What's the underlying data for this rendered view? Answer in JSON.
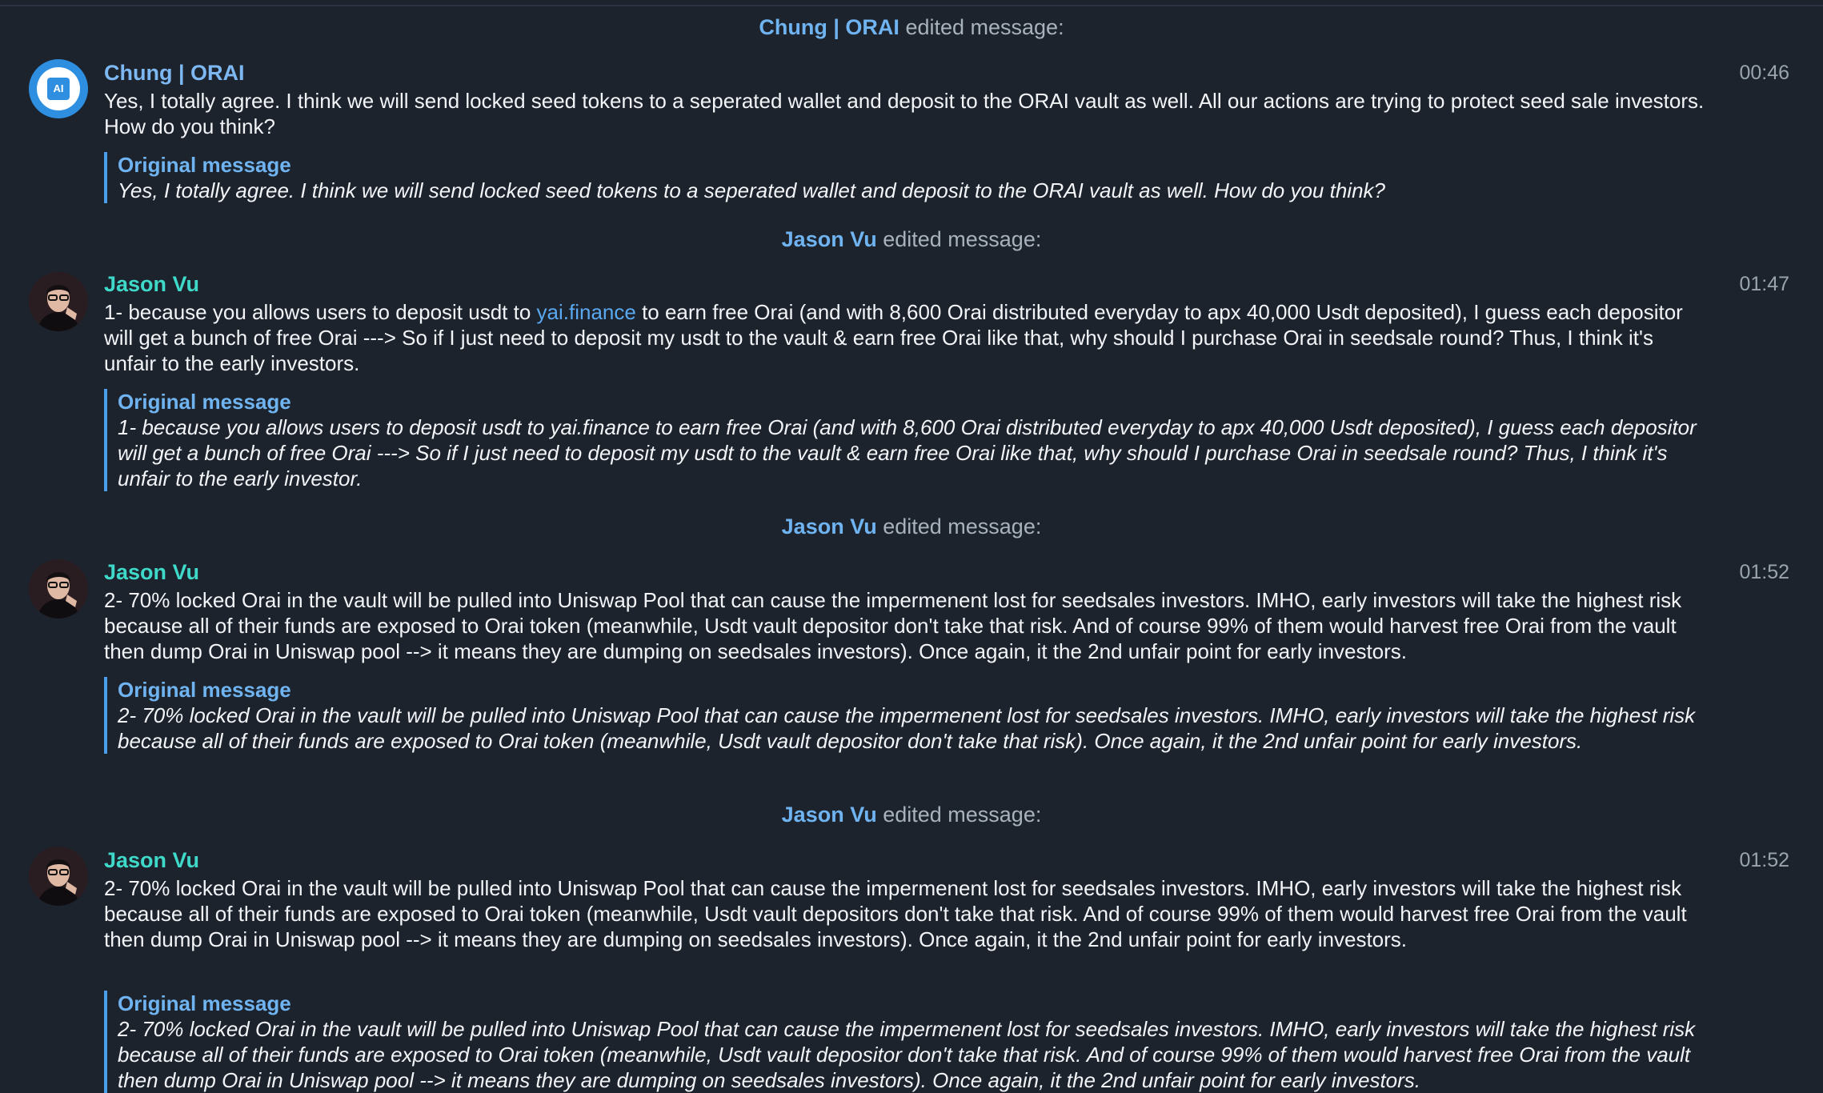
{
  "colors": {
    "background": "#1c232d",
    "link": "#5aa9f0",
    "orai_name": "#7eb8f2",
    "jason_name": "#3fd9c9",
    "quote_bar": "#4a9fea"
  },
  "notices": [
    {
      "name": "Chung | ORAI",
      "suffix": "edited message:"
    },
    {
      "name": "Jason Vu",
      "suffix": "edited message:"
    },
    {
      "name": "Jason Vu",
      "suffix": "edited message:"
    },
    {
      "name": "Jason Vu",
      "suffix": "edited message:"
    }
  ],
  "messages": [
    {
      "sender": "Chung | ORAI",
      "avatar_icon": "orai-ai-logo-icon",
      "avatar_text": "AI",
      "time": "00:46",
      "text": "Yes, I totally agree. I think we will send locked seed tokens to a seperated wallet and deposit to the ORAI vault as well. All our actions are trying to protect seed sale investors. How do you think?",
      "original_title": "Original message",
      "original_text": "Yes, I totally agree. I think we will send locked seed tokens to a seperated wallet and deposit to the ORAI vault as well. How do you think?"
    },
    {
      "sender": "Jason Vu",
      "avatar_icon": "user-photo-icon",
      "time": "01:47",
      "text_before_link": "1- because you allows users to deposit usdt to ",
      "link": "yai.finance",
      "text_after_link": " to earn free Orai (and with 8,600 Orai distributed everyday to apx 40,000 Usdt deposited), I guess each depositor will get a bunch of free Orai ---> So if I just need to deposit my usdt to the vault & earn free Orai like that, why should I purchase Orai in seedsale round? Thus, I think it's unfair to the early investors.",
      "original_title": "Original message",
      "original_text": "1- because you allows users to deposit usdt to yai.finance to earn free Orai (and with 8,600 Orai distributed everyday to apx 40,000 Usdt deposited), I guess each depositor will get a bunch of free Orai ---> So if I just need to deposit my usdt to the vault & earn free Orai like that, why should I purchase Orai in seedsale round? Thus, I think it's unfair to the early investor."
    },
    {
      "sender": "Jason Vu",
      "avatar_icon": "user-photo-icon",
      "time": "01:52",
      "text": "2- 70% locked Orai in the vault will be pulled into Uniswap Pool that can cause the impermenent lost for seedsales investors. IMHO, early investors will take the highest risk because all of their funds are exposed to Orai token (meanwhile, Usdt vault depositor don't take that risk. And of course 99% of them would harvest free Orai from the vault then dump Orai in Uniswap pool --> it means they are dumping on seedsales investors). Once again, it the 2nd unfair point for early investors.",
      "original_title": "Original message",
      "original_text": "2- 70% locked Orai in the vault will be pulled into Uniswap Pool that can cause the impermenent lost for seedsales investors. IMHO, early investors will take the highest risk because all of their funds are exposed to Orai token (meanwhile, Usdt vault depositor don't take that risk). Once again, it the 2nd unfair point for early investors."
    },
    {
      "sender": "Jason Vu",
      "avatar_icon": "user-photo-icon",
      "time": "01:52",
      "text": "2- 70% locked Orai in the vault will be pulled into Uniswap Pool that can cause the impermenent lost for seedsales investors. IMHO, early investors will take the highest risk because all of their funds are exposed to Orai token (meanwhile, Usdt vault depositors don't take that risk. And of course 99% of them would harvest free Orai from the vault then dump Orai in Uniswap pool --> it means they are dumping on seedsales investors). Once again, it the 2nd unfair point for early investors.",
      "original_title": "Original message",
      "original_text": "2- 70% locked Orai in the vault will be pulled into Uniswap Pool that can cause the impermenent lost for seedsales investors. IMHO, early investors will take the highest risk because all of their funds are exposed to Orai token (meanwhile, Usdt vault depositor don't take that risk. And of course 99% of them would harvest free Orai from the vault then dump Orai in Uniswap pool --> it means they are dumping on seedsales investors). Once again, it the 2nd unfair point for early investors."
    }
  ]
}
